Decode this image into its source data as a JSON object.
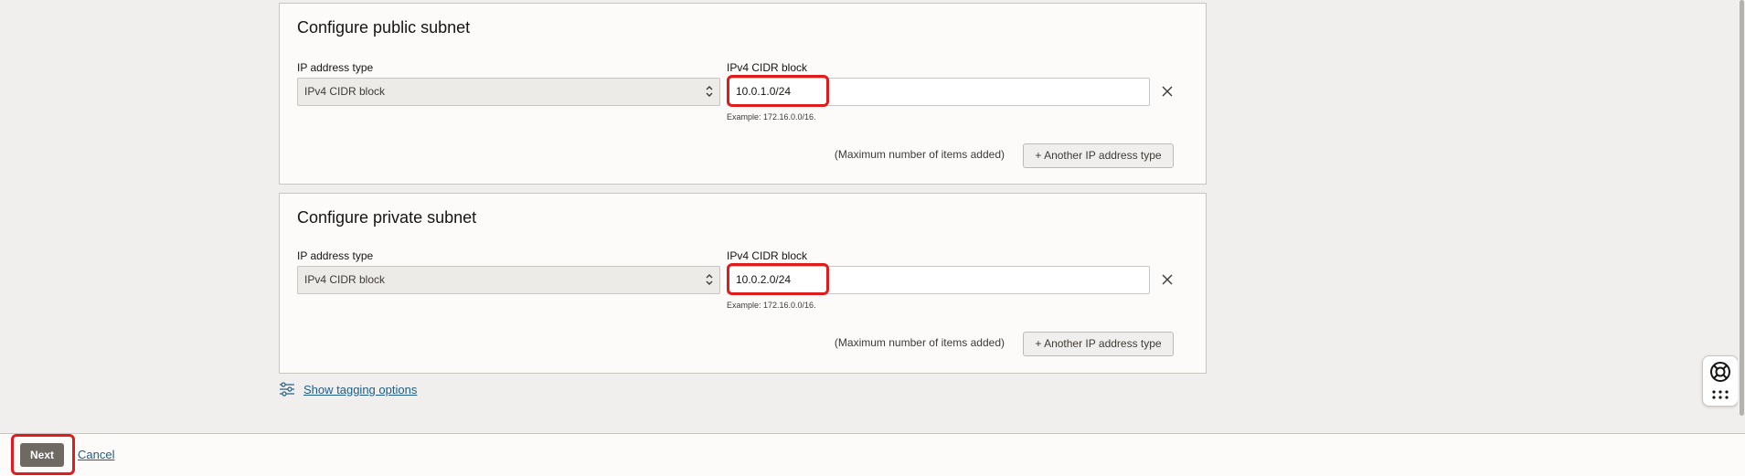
{
  "public_subnet": {
    "title": "Configure public subnet",
    "ip_type_label": "IP address type",
    "ip_type_value": "IPv4 CIDR block",
    "cidr_label": "IPv4 CIDR block",
    "cidr_value": "10.0.1.0/24",
    "cidr_hint": "Example: 172.16.0.0/16.",
    "max_note": "(Maximum number of items added)",
    "another_button": "+ Another IP address type"
  },
  "private_subnet": {
    "title": "Configure private subnet",
    "ip_type_label": "IP address type",
    "ip_type_value": "IPv4 CIDR block",
    "cidr_label": "IPv4 CIDR block",
    "cidr_value": "10.0.2.0/24",
    "cidr_hint": "Example: 172.16.0.0/16.",
    "max_note": "(Maximum number of items added)",
    "another_button": "+ Another IP address type"
  },
  "tagging": {
    "label": "Show tagging options"
  },
  "footer": {
    "next_label": "Next",
    "cancel_label": "Cancel"
  },
  "colors": {
    "highlight": "#e01b1b",
    "link": "#1f5c87",
    "primary_button": "#6f6964"
  }
}
